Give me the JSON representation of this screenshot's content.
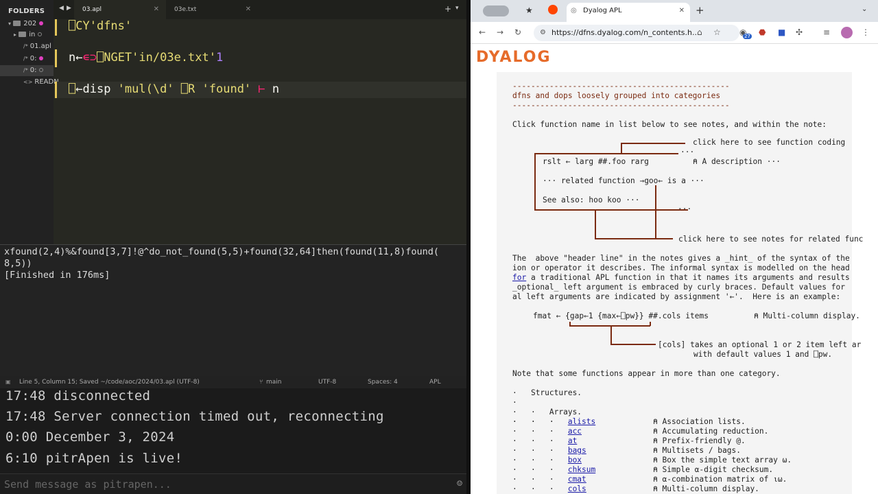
{
  "editor": {
    "folders_header": "FOLDERS",
    "tree": [
      {
        "label": "202"
      },
      {
        "label": "in"
      },
      {
        "label": "01.apl"
      },
      {
        "label": "0:"
      },
      {
        "label": "0:"
      },
      {
        "label": "READN"
      }
    ],
    "tabs": [
      {
        "label": "03.apl"
      },
      {
        "label": "03e.txt"
      }
    ],
    "code": {
      "line1_q": "⎕CY",
      "line1_str": "'dfns'",
      "line2_a": "n←",
      "line2_b": "∊",
      "line2_c": "⊃",
      "line2_d": "⎕NGET",
      "line2_str": "'in/03e.txt'",
      "line2_num": "1",
      "line3_a": "⎕",
      "line3_b": "←disp ",
      "line3_str1": "'mul(\\d'",
      "line3_r": " ⎕R ",
      "line3_str2": "'found'",
      "line3_op": " ⊢ ",
      "line3_n": "n"
    },
    "output": [
      "xfound(2,4)%&found[3,7]!@^do_not_found(5,5)+found(32,64]then(found(11,8)found(",
      "8,5))",
      "[Finished in 176ms]"
    ],
    "status": {
      "position": "Line 5, Column 15; Saved ~/code/aoc/2024/03.apl (UTF-8)",
      "branch": "main",
      "encoding": "UTF-8",
      "spaces": "Spaces: 4",
      "syntax": "APL"
    }
  },
  "chat": {
    "messages": [
      "17:48 disconnected",
      "17:48 Server connection timed out, reconnecting",
      "0:00 December 3, 2024",
      "6:10 pitrApen is live!"
    ],
    "input_placeholder": "Send message as pitrapen..."
  },
  "browser": {
    "tab_title": "Dyalog APL",
    "url": "https://dfns.dyalog.com/n_contents.h...",
    "badge_count": "27",
    "logo": "DYALOG",
    "doc": {
      "rule": "-----------------------------------------------",
      "heading": "dfns and dops loosely grouped into categories",
      "intro": "Click function name in list below to see notes, and within the note:",
      "click_coding": "click here to see function coding",
      "dots1": "···",
      "header_line": "rslt ← larg ##.foo rarg",
      "description": "⍝ A description ···",
      "related_prefix": "··· related function ",
      "related_goo": "→goo←",
      "related_suffix": " is a ···",
      "see_also": "See also: hoo koo ···",
      "dots2": "···",
      "click_related": "click here to see notes for related func",
      "p1_l1": "The  above \"header line\" in the notes gives a _hint_ of the syntax of the",
      "p1_l2": "ion or operator it describes. The informal syntax is modelled on the head",
      "p1_l3_link": "for",
      "p1_l3": " a traditional APL function in that it names its arguments and results",
      "p1_l4": "_optional_ left argument is embraced by curly braces. Default values for",
      "p1_l5": "al left arguments are indicated by assignment '←'.  Here is an example:",
      "fmat": "fmat ← {gap←1 {max←⎕pw}} ##.cols items",
      "fmat_desc": "⍝ Multi-column display.",
      "cols_note1": "[cols] takes an optional 1 or 2 item left ar",
      "cols_note2": "with default values 1 and ⎕pw.",
      "note": "Note that some functions appear in more than one category.",
      "structures": "Structures.",
      "arrays": "Arrays.",
      "entries": [
        {
          "name": "alists",
          "desc": "⍝ Association lists."
        },
        {
          "name": "acc",
          "desc": "⍝ Accumulating reduction."
        },
        {
          "name": "at",
          "desc": "⍝ Prefix-friendly @."
        },
        {
          "name": "bags",
          "desc": "⍝ Multisets / bags."
        },
        {
          "name": "box",
          "desc": "⍝ Box the simple text array ⍵."
        },
        {
          "name": "chksum",
          "desc": "⍝ Simple ⍺-digit checksum."
        },
        {
          "name": "cmat",
          "desc": "⍝ ⍺-combination matrix of ⍳⍵."
        },
        {
          "name": "cols",
          "desc": "⍝ Multi-column display."
        }
      ]
    }
  }
}
